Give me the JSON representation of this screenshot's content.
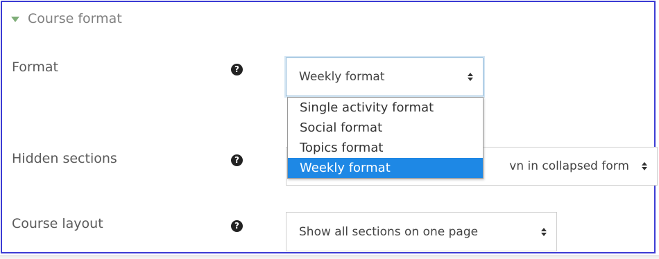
{
  "section": {
    "title": "Course format",
    "expanded_icon": "caret-down-icon"
  },
  "format": {
    "label": "Format",
    "help_icon": "question-circle-icon",
    "selected_value": "Weekly format",
    "options": [
      "Single activity format",
      "Social format",
      "Topics format",
      "Weekly format"
    ],
    "highlighted_option": "Weekly format"
  },
  "hidden_sections": {
    "label": "Hidden sections",
    "help_icon": "question-circle-icon",
    "visible_value": "vn in collapsed form"
  },
  "course_layout": {
    "label": "Course layout",
    "help_icon": "question-circle-icon",
    "selected_value": "Show all sections on one page"
  },
  "colors": {
    "frame_border": "#3b3bd4",
    "highlight": "#1e88e5",
    "caret": "#7fae79"
  }
}
